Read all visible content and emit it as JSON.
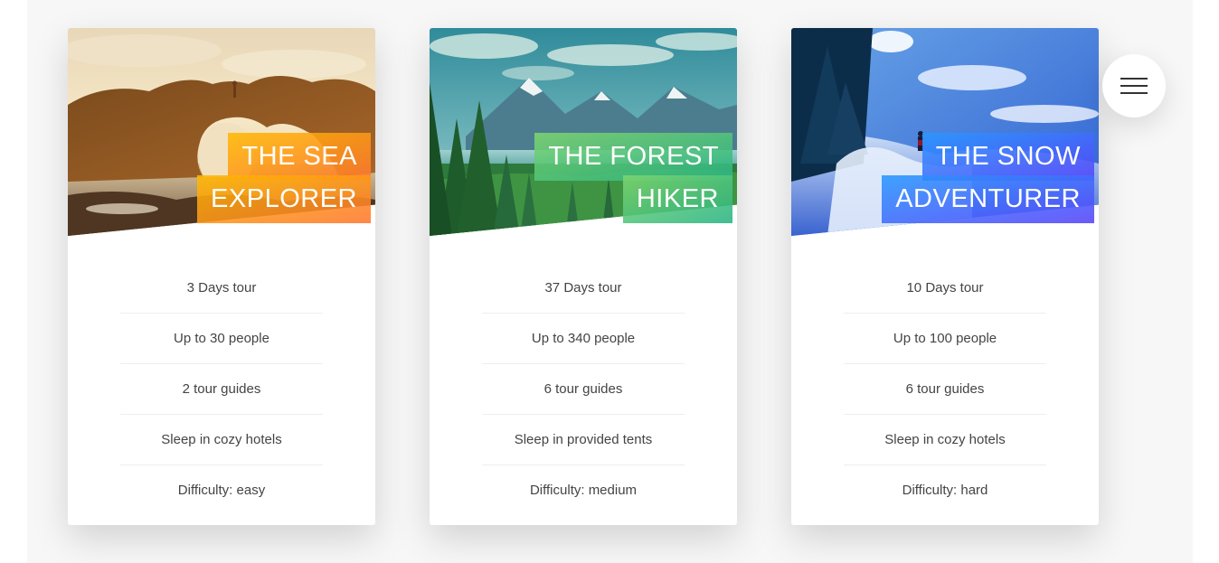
{
  "navigation": {
    "icon": "hamburger-menu-icon"
  },
  "tours": [
    {
      "heading_line1": "THE SEA",
      "heading_line2": "EXPLORER",
      "image": "sea-arch-icon",
      "details": [
        "3 Days tour",
        "Up to 30 people",
        "2 tour guides",
        "Sleep in cozy hotels",
        "Difficulty: easy"
      ],
      "accent_from": "#ffb900",
      "accent_to": "#ff7730"
    },
    {
      "heading_line1": "THE FOREST",
      "heading_line2": "HIKER",
      "image": "forest-mountains-icon",
      "details": [
        "37 Days tour",
        "Up to 340 people",
        "6 tour guides",
        "Sleep in provided tents",
        "Difficulty: medium"
      ],
      "accent_from": "#7ed56f",
      "accent_to": "#28b485"
    },
    {
      "heading_line1": "THE SNOW",
      "heading_line2": "ADVENTURER",
      "image": "snow-trail-icon",
      "details": [
        "10 Days tour",
        "Up to 100 people",
        "6 tour guides",
        "Sleep in cozy hotels",
        "Difficulty: hard"
      ],
      "accent_from": "#2998ff",
      "accent_to": "#5643fa"
    }
  ]
}
